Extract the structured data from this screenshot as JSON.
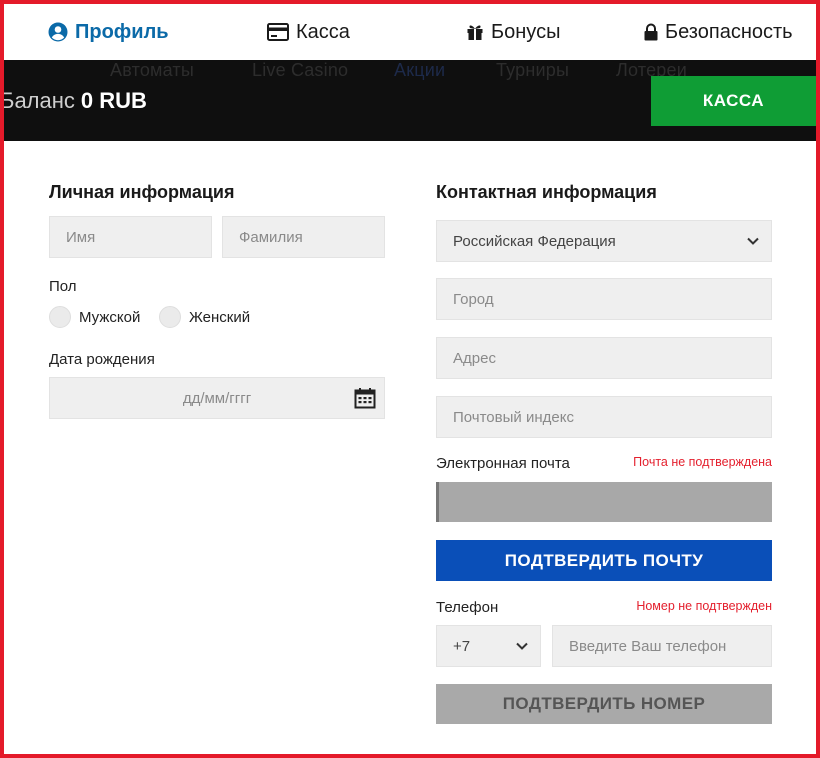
{
  "tabs": [
    {
      "label": "Профиль",
      "icon": "user-icon",
      "active": true
    },
    {
      "label": "Касса",
      "icon": "card-icon",
      "active": false
    },
    {
      "label": "Бонусы",
      "icon": "gift-icon",
      "active": false
    },
    {
      "label": "Безопасность",
      "icon": "lock-icon",
      "active": false
    }
  ],
  "topbar": {
    "ghost_nav": [
      "Автоматы",
      "Live Casino",
      "Акции",
      "Турниры",
      "Лотереи"
    ],
    "balance_label": "Баланс",
    "balance_amount": "0 RUB",
    "kassa_button": "КАССА"
  },
  "personal": {
    "title": "Личная информация",
    "first_name_placeholder": "Имя",
    "last_name_placeholder": "Фамилия",
    "gender_label": "Пол",
    "gender_male": "Мужской",
    "gender_female": "Женский",
    "birthdate_label": "Дата рождения",
    "birthdate_placeholder": "дд/мм/гггг"
  },
  "contact": {
    "title": "Контактная информация",
    "country_value": "Российская Федерация",
    "city_placeholder": "Город",
    "address_placeholder": "Адрес",
    "zip_placeholder": "Почтовый индекс",
    "email_label": "Электронная почта",
    "email_status": "Почта не подтверждена",
    "confirm_email_button": "ПОДТВЕРДИТЬ ПОЧТУ",
    "phone_label": "Телефон",
    "phone_status": "Номер не подтвержден",
    "phone_code": "+7",
    "phone_placeholder": "Введите Ваш телефон",
    "confirm_phone_button": "ПОДТВЕРДИТЬ НОМЕР"
  },
  "colors": {
    "frame_border": "#e41a2a",
    "active_tab": "#0b6aa8",
    "kassa_green": "#0f9d35",
    "confirm_blue": "#0a4fb8",
    "warning_red": "#e4202e"
  }
}
